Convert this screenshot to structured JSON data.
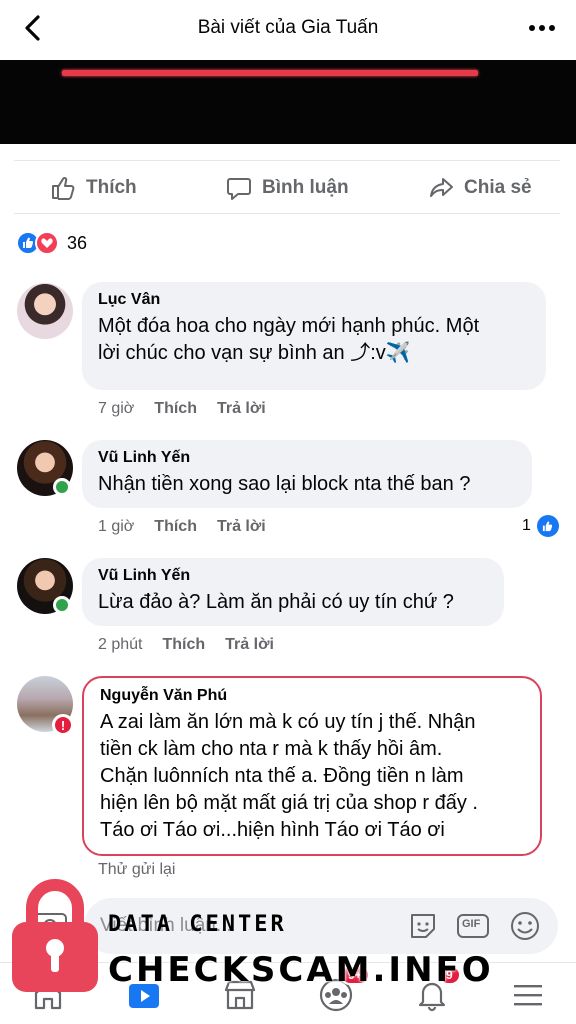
{
  "header": {
    "title": "Bài viết của Gia Tuấn"
  },
  "actions": {
    "like": "Thích",
    "comment": "Bình luận",
    "share": "Chia sẻ"
  },
  "reactions": {
    "count": "36"
  },
  "comments": [
    {
      "name": "Lục Vân",
      "lines": [
        "Một đóa hoa cho ngày mới hạnh phúc. Một",
        "lời chúc cho vạn sự bình an ⤴:v✈️"
      ],
      "time": "7 giờ",
      "like": "Thích",
      "reply": "Trả lời"
    },
    {
      "name": "Vũ Linh Yến",
      "lines": [
        "Nhận tiền xong sao lại block nta thế ban ?"
      ],
      "time": "1 giờ",
      "like": "Thích",
      "reply": "Trả lời",
      "like_count": "1"
    },
    {
      "name": "Vũ Linh Yến",
      "lines": [
        "Lừa đảo à? Làm ăn phải có uy tín chứ ?"
      ],
      "time": "2 phút",
      "like": "Thích",
      "reply": "Trả lời"
    },
    {
      "name": "Nguyễn Văn Phú",
      "lines": [
        "A zai làm ăn lớn mà k có uy tín j thế. Nhận",
        "tiền ck làm cho nta r mà k thấy hồi âm.",
        "Chặn luônních nta thế a. Đồng tiền n làm",
        "hiện lên bộ mặt mất giá trị của shop r đấy .",
        "Táo ơi Táo ơi...hiện hình Táo ơi Táo ơi"
      ],
      "retry": "Thử gửi lại"
    }
  ],
  "composer": {
    "placeholder": "Viết bình luận...",
    "gif_label": "GIF"
  },
  "nav": {
    "badge_groups": "9+",
    "badge_notifications": "9"
  },
  "watermark": {
    "small": "DATA CENTER",
    "big": "CHECKSCAM.INFO"
  },
  "colors": {
    "accent": "#1877f2",
    "error": "#d8425c",
    "online": "#31a24c"
  }
}
